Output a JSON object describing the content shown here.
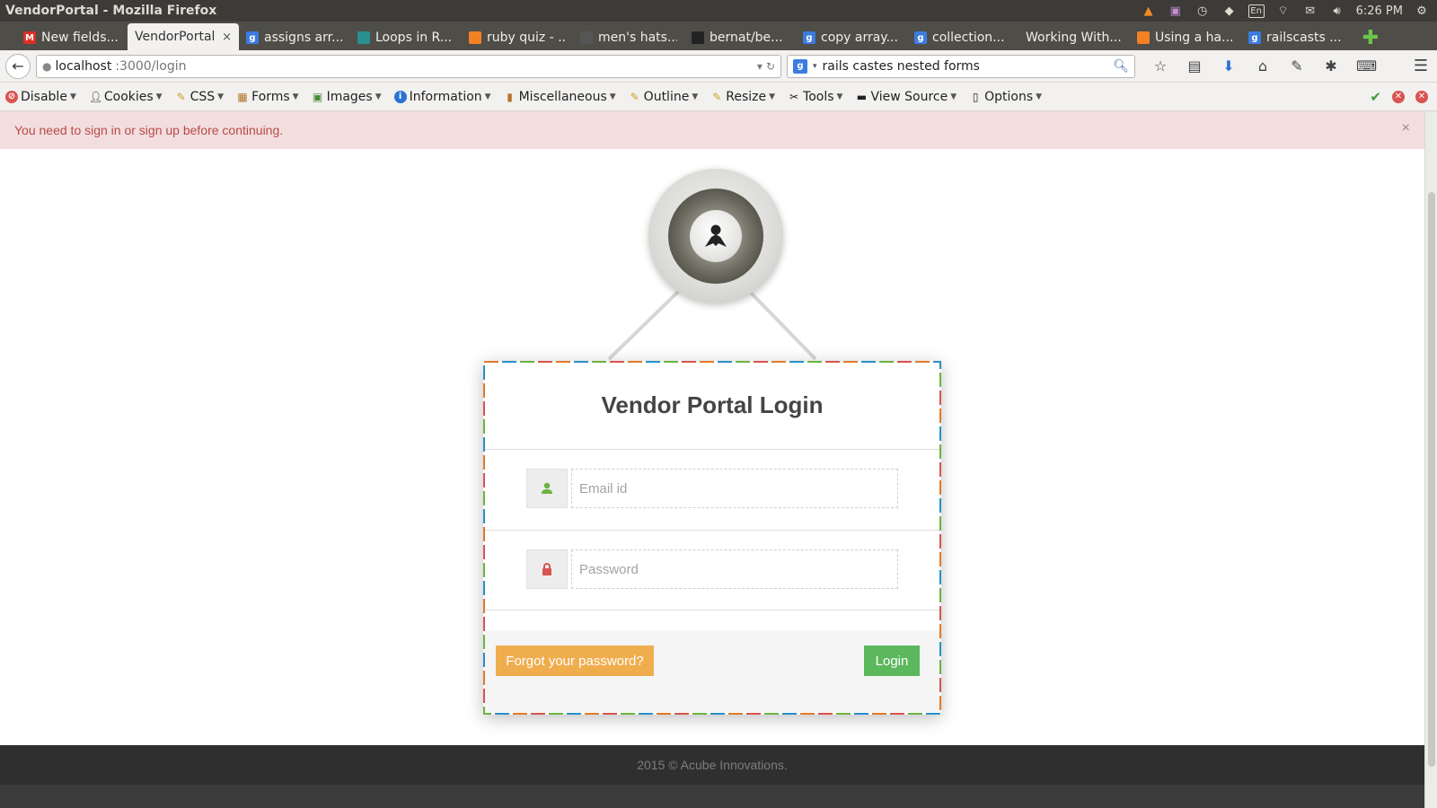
{
  "os": {
    "window_title": "VendorPortal - Mozilla Firefox",
    "clock": "6:26 PM",
    "keyboard": "En"
  },
  "tabs": [
    {
      "label": "New fields...",
      "icon": "gmail-icon",
      "color": "#d93025"
    },
    {
      "label": "VendorPortal",
      "icon": "",
      "color": "",
      "active": true
    },
    {
      "label": "assigns arr...",
      "icon": "google-icon",
      "color": "#3b7ce0"
    },
    {
      "label": "Loops in R...",
      "icon": "bookmark-icon",
      "color": "#2a8f8f"
    },
    {
      "label": "ruby quiz - ...",
      "icon": "stackoverflow-icon",
      "color": "#f48024"
    },
    {
      "label": "men's hats...",
      "icon": "page-icon",
      "color": "#555555"
    },
    {
      "label": "bernat/be...",
      "icon": "github-icon",
      "color": "#222222"
    },
    {
      "label": "copy array...",
      "icon": "google-icon",
      "color": "#3b7ce0"
    },
    {
      "label": "collection...",
      "icon": "google-icon",
      "color": "#3b7ce0"
    },
    {
      "label": "Working With...",
      "icon": "",
      "color": ""
    },
    {
      "label": "Using a ha...",
      "icon": "stackoverflow-icon",
      "color": "#f48024"
    },
    {
      "label": "railscasts ...",
      "icon": "google-icon",
      "color": "#3b7ce0"
    }
  ],
  "nav": {
    "url_host": "localhost",
    "url_path": ":3000/login",
    "search_value": "rails castes nested forms"
  },
  "dev_toolbar": {
    "items": [
      "Disable",
      "Cookies",
      "CSS",
      "Forms",
      "Images",
      "Information",
      "Miscellaneous",
      "Outline",
      "Resize",
      "Tools",
      "View Source",
      "Options"
    ]
  },
  "page": {
    "flash_message": "You need to sign in or sign up before continuing.",
    "flash_close": "×",
    "login_title": "Vendor Portal Login",
    "email_placeholder": "Email id",
    "password_placeholder": "Password",
    "forgot_label": "Forgot your password?",
    "login_label": "Login",
    "footer_text": "2015 © Acube Innovations."
  },
  "colors": {
    "flash_bg": "#f2dede",
    "flash_text": "#b94a48",
    "forgot_btn": "#f0ad4e",
    "login_btn": "#5cb85c",
    "user_icon": "#6cb33f",
    "lock_icon": "#d9534f",
    "border_dashes": [
      "#e07a2a",
      "#2a8fc7",
      "#6cb33f",
      "#d9534f"
    ]
  }
}
